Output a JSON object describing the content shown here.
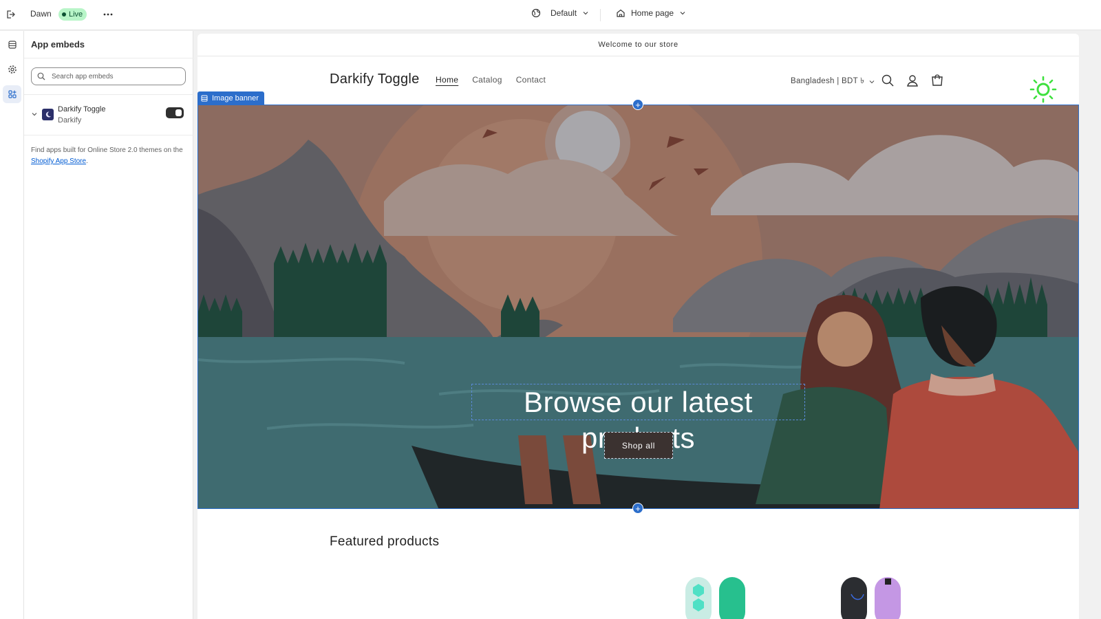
{
  "topbar": {
    "theme_name": "Dawn",
    "status_badge": "Live",
    "view_selector": "Default",
    "page_selector": "Home page"
  },
  "panel": {
    "title": "App embeds",
    "search_placeholder": "Search app embeds",
    "embed": {
      "name": "Darkify Toggle",
      "vendor": "Darkify",
      "enabled": true
    },
    "find_text_prefix": "Find apps built for Online Store 2.0 themes on the ",
    "find_link": "Shopify App Store",
    "find_text_suffix": "."
  },
  "store": {
    "announcement": "Welcome to our store",
    "logo": "Darkify Toggle",
    "nav": [
      "Home",
      "Catalog",
      "Contact"
    ],
    "country": "Bangladesh | BDT ৳",
    "section_tag": "Image banner",
    "banner_heading": "Browse our latest products",
    "banner_button": "Shop all",
    "featured_heading": "Featured products"
  },
  "colors": {
    "accent_blue": "#2c6ecb",
    "live_green": "#b8f5c8",
    "sun_green": "#3ee03e"
  }
}
